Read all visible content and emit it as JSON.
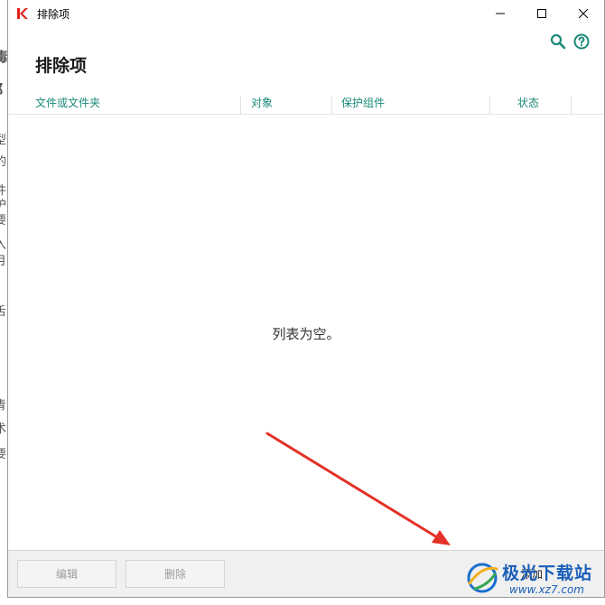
{
  "window": {
    "title": "排除项",
    "page_title": "排除项"
  },
  "table": {
    "columns": [
      "文件或文件夹",
      "对象",
      "保护组件",
      "状态"
    ],
    "empty_message": "列表为空。"
  },
  "footer": {
    "edit_label": "编辑",
    "delete_label": "删除",
    "add_label": "添加"
  },
  "background_window": {
    "fragments": [
      "毒",
      "阝",
      "型",
      "的",
      "件",
      "护",
      "要",
      "入",
      "月",
      "舌",
      "青",
      "术",
      "要"
    ]
  },
  "watermark": {
    "text": "极光下载站",
    "url": "www.xz7.com"
  },
  "icons": {
    "app": "kaspersky-k-icon",
    "search": "search-icon",
    "help": "help-icon"
  },
  "colors": {
    "accent": "#1a8a78",
    "brand": "#e0201b",
    "arrow": "#e53127"
  }
}
